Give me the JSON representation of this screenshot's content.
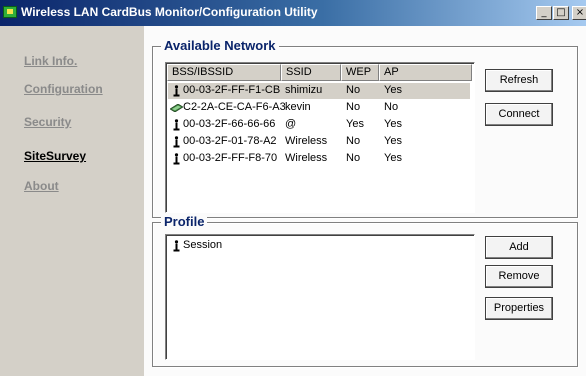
{
  "window": {
    "title": "Wireless LAN CardBus Monitor/Configuration Utility",
    "minimize_glyph": "_",
    "maximize_glyph": "□",
    "close_glyph": "×"
  },
  "sidebar": {
    "items": [
      {
        "label": "Link Info."
      },
      {
        "label": "Configuration"
      },
      {
        "label": "Security"
      },
      {
        "label": "SiteSurvey"
      },
      {
        "label": "About"
      }
    ],
    "active_item": "SiteSurvey"
  },
  "available_network": {
    "title": "Available Network",
    "columns": [
      "BSS/IBSSID",
      "SSID",
      "WEP",
      "AP"
    ],
    "rows": [
      {
        "icon": "station-icon",
        "bssid": "00-03-2F-FF-F1-CB",
        "ssid": "shimizu",
        "wep": "No",
        "ap": "Yes",
        "selected": true
      },
      {
        "icon": "card-icon",
        "bssid": "C2-2A-CE-CA-F6-A3",
        "ssid": "kevin",
        "wep": "No",
        "ap": "No",
        "selected": false
      },
      {
        "icon": "station-icon",
        "bssid": "00-03-2F-66-66-66",
        "ssid": "@",
        "wep": "Yes",
        "ap": "Yes",
        "selected": false
      },
      {
        "icon": "station-icon",
        "bssid": "00-03-2F-01-78-A2",
        "ssid": "Wireless",
        "wep": "No",
        "ap": "Yes",
        "selected": false
      },
      {
        "icon": "station-icon",
        "bssid": "00-03-2F-FF-F8-70",
        "ssid": "Wireless",
        "wep": "No",
        "ap": "Yes",
        "selected": false
      }
    ],
    "buttons": {
      "refresh": "Refresh",
      "connect": "Connect"
    }
  },
  "profile": {
    "title": "Profile",
    "items": [
      {
        "icon": "station-icon",
        "label": "Session"
      }
    ],
    "buttons": {
      "add": "Add",
      "remove": "Remove",
      "properties": "Properties"
    }
  },
  "colors": {
    "title_bar_start": "#0a246a",
    "title_bar_end": "#a6caf0",
    "group_title": "#0a246a",
    "nav_inactive": "#8a8a8a",
    "nav_active": "#000000"
  }
}
